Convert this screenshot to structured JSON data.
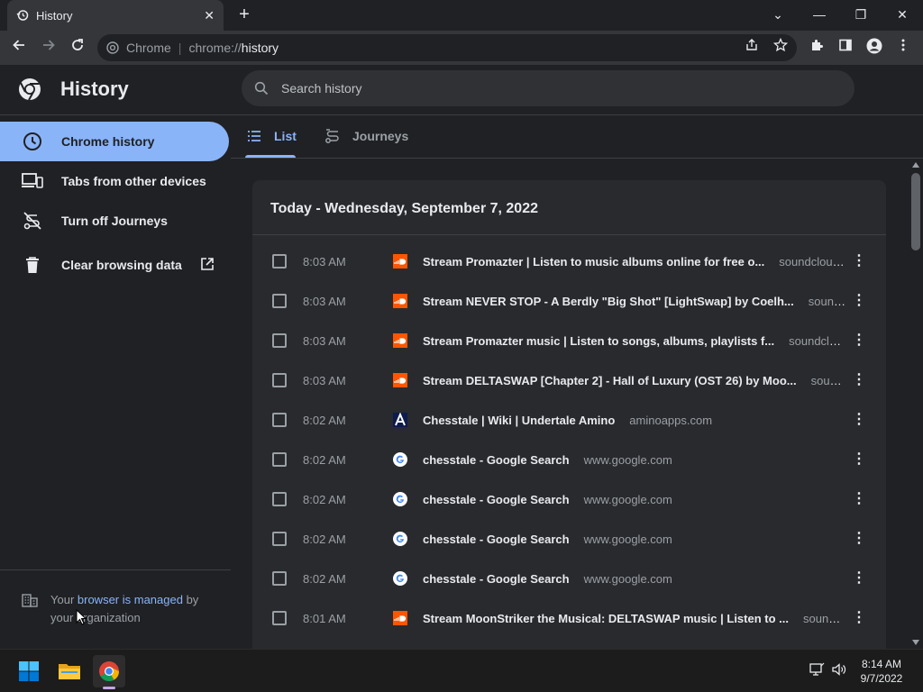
{
  "window": {
    "tab_title": "History",
    "tab_close": "✕",
    "new_tab": "+",
    "controls": {
      "dropdown": "⌄",
      "minimize": "—",
      "restore": "❐",
      "close": "✕"
    }
  },
  "toolbar": {
    "site_label": "Chrome",
    "url_scheme": "chrome://",
    "url_path": "history"
  },
  "page": {
    "title": "History",
    "search_placeholder": "Search history"
  },
  "sidebar": {
    "items": [
      {
        "label": "Chrome history",
        "icon": "clock-icon",
        "active": true
      },
      {
        "label": "Tabs from other devices",
        "icon": "devices-icon",
        "active": false
      },
      {
        "label": "Turn off Journeys",
        "icon": "journeys-off-icon",
        "active": false
      },
      {
        "label": "Clear browsing data",
        "icon": "trash-icon",
        "active": false
      }
    ],
    "managed": {
      "prefix": "Your ",
      "link": "browser is managed",
      "suffix": " by your organization"
    }
  },
  "tabs": [
    {
      "label": "List",
      "active": true
    },
    {
      "label": "Journeys",
      "active": false
    }
  ],
  "history": {
    "date_heading": "Today - Wednesday, September 7, 2022",
    "rows": [
      {
        "time": "8:03 AM",
        "favicon": "soundcloud",
        "title": "Stream Promazter | Listen to music albums online for free o...",
        "domain": "soundcloud...."
      },
      {
        "time": "8:03 AM",
        "favicon": "soundcloud",
        "title": "Stream NEVER STOP - A Berdly \"Big Shot\" [LightSwap] by Coelh...",
        "domain": "soundclo..."
      },
      {
        "time": "8:03 AM",
        "favicon": "soundcloud",
        "title": "Stream Promazter music | Listen to songs, albums, playlists f...",
        "domain": "soundclou..."
      },
      {
        "time": "8:03 AM",
        "favicon": "soundcloud",
        "title": "Stream DELTASWAP [Chapter 2] - Hall of Luxury (OST 26) by Moo...",
        "domain": "sound..."
      },
      {
        "time": "8:02 AM",
        "favicon": "amino",
        "title": "Chesstale | Wiki | Undertale Amino",
        "domain": "aminoapps.com"
      },
      {
        "time": "8:02 AM",
        "favicon": "google",
        "title": "chesstale - Google Search",
        "domain": "www.google.com"
      },
      {
        "time": "8:02 AM",
        "favicon": "google",
        "title": "chesstale - Google Search",
        "domain": "www.google.com"
      },
      {
        "time": "8:02 AM",
        "favicon": "google",
        "title": "chesstale - Google Search",
        "domain": "www.google.com"
      },
      {
        "time": "8:02 AM",
        "favicon": "google",
        "title": "chesstale - Google Search",
        "domain": "www.google.com"
      },
      {
        "time": "8:01 AM",
        "favicon": "soundcloud",
        "title": "Stream MoonStriker the Musical: DELTASWAP music | Listen to ...",
        "domain": "soundcl..."
      }
    ]
  },
  "taskbar": {
    "time": "8:14 AM",
    "date": "9/7/2022"
  },
  "colors": {
    "accent": "#8ab4f8",
    "soundcloud": "#ff5500",
    "background": "#202124",
    "card": "#292a2d"
  }
}
